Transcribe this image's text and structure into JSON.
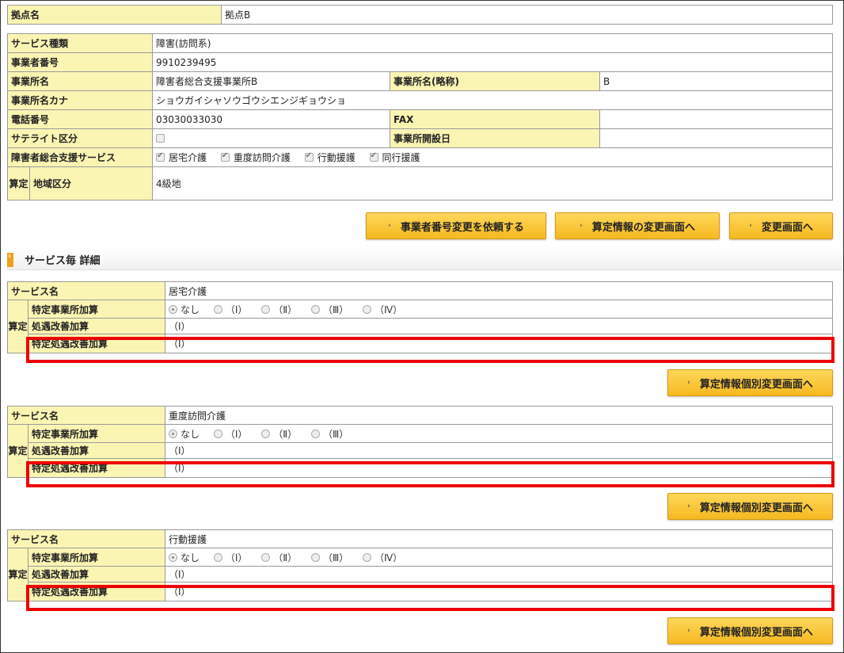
{
  "office": {
    "base_label": "拠点名",
    "base_value": "拠点B",
    "service_type_label": "サービス種類",
    "service_type_value": "障害(訪問系)",
    "provider_no_label": "事業者番号",
    "provider_no_value": "9910239495",
    "office_name_label": "事業所名",
    "office_name_value": "障害者総合支援事業所B",
    "office_short_label": "事業所名(略称)",
    "office_short_value": "B",
    "office_kana_label": "事業所名カナ",
    "office_kana_value": "ショウガイシャソウゴウシエンジギョウショ",
    "phone_label": "電話番号",
    "phone_value": "03030033030",
    "fax_label": "FAX",
    "fax_value": "",
    "satellite_label": "サテライト区分",
    "opening_label": "事業所開設日",
    "opening_value": "",
    "support_label": "障害者総合支援サービス",
    "support_services": [
      "居宅介護",
      "重度訪問介護",
      "行動援護",
      "同行援護"
    ],
    "santei_label": "算定",
    "region_label": "地域区分",
    "region_value": "4級地"
  },
  "buttons": {
    "request_change": "事業者番号変更を依頼する",
    "calc_change": "算定情報の変更画面へ",
    "change": "変更画面へ",
    "individual_change": "算定情報個別変更画面へ"
  },
  "section_title": "サービス毎 詳細",
  "services": [
    {
      "name_label": "サービス名",
      "name_value": "居宅介護",
      "santei_label": "算定",
      "r1_label": "特定事業所加算",
      "options": [
        "なし",
        "（Ⅰ）",
        "（Ⅱ）",
        "（Ⅲ）",
        "（Ⅳ）"
      ],
      "r2_label": "処遇改善加算",
      "r2_value": "（Ⅰ）",
      "r3_label": "特定処遇改善加算",
      "r3_value": "（Ⅰ）"
    },
    {
      "name_label": "サービス名",
      "name_value": "重度訪問介護",
      "santei_label": "算定",
      "r1_label": "特定事業所加算",
      "options": [
        "なし",
        "（Ⅰ）",
        "（Ⅱ）",
        "（Ⅲ）"
      ],
      "r2_label": "処遇改善加算",
      "r2_value": "（Ⅰ）",
      "r3_label": "特定処遇改善加算",
      "r3_value": "（Ⅰ）"
    },
    {
      "name_label": "サービス名",
      "name_value": "行動援護",
      "santei_label": "算定",
      "r1_label": "特定事業所加算",
      "options": [
        "なし",
        "（Ⅰ）",
        "（Ⅱ）",
        "（Ⅲ）",
        "（Ⅳ）"
      ],
      "r2_label": "処遇改善加算",
      "r2_value": "（Ⅰ）",
      "r3_label": "特定処遇改善加算",
      "r3_value": "（Ⅰ）"
    }
  ]
}
